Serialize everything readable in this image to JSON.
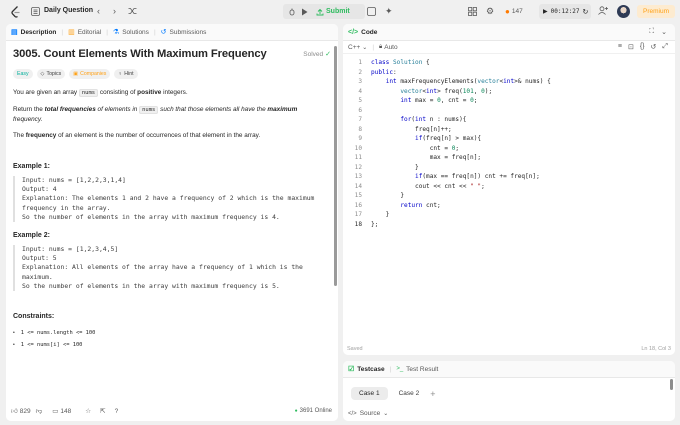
{
  "topbar": {
    "title": "Daily Question",
    "submit_label": "Submit",
    "streak": "147",
    "timer": "00:12:27",
    "premium_label": "Premium"
  },
  "left_tabs": [
    {
      "label": "Description"
    },
    {
      "label": "Editorial"
    },
    {
      "label": "Solutions"
    },
    {
      "label": "Submissions"
    }
  ],
  "problem": {
    "title": "3005. Count Elements With Maximum Frequency",
    "status": "Solved",
    "tags": {
      "difficulty": "Easy",
      "topics": "Topics",
      "companies": "Companies",
      "hint": "Hint"
    },
    "p1_pre": "You are given an array ",
    "p1_code": "nums",
    "p1_mid": " consisting of ",
    "p1_bold": "positive",
    "p1_post": " integers.",
    "p2_pre": "Return the ",
    "p2_bold": "total frequencies",
    "p2_mid": " of elements in ",
    "p2_code": "nums",
    "p2_mid2": " such that those elements all have the ",
    "p2_bold2": "maximum",
    "p2_post": " frequency.",
    "p3_pre": "The ",
    "p3_bold": "frequency",
    "p3_post": " of an element is the number of occurrences of that element in the array.",
    "example1_title": "Example 1:",
    "example1_body": "Input: nums = [1,2,2,3,1,4]\nOutput: 4\nExplanation: The elements 1 and 2 have a frequency of 2 which is the maximum\nfrequency in the array.\nSo the number of elements in the array with maximum frequency is 4.",
    "example2_title": "Example 2:",
    "example2_body": "Input: nums = [1,2,3,4,5]\nOutput: 5\nExplanation: All elements of the array have a frequency of 1 which is the\nmaximum.\nSo the number of elements in the array with maximum frequency is 5.",
    "constraints_title": "Constraints:",
    "constraint1": "1 <= nums.length <= 100",
    "constraint2": "1 <= nums[i] <= 100"
  },
  "left_footer": {
    "likes": "829",
    "comments": "148",
    "online": "3691 Online"
  },
  "code_panel": {
    "title": "Code",
    "language": "C++",
    "auto_label": "Auto",
    "saved": "Saved",
    "cursor": "Ln 18, Col 3"
  },
  "code_lines": [
    {
      "n": "1",
      "html": "<span class=\"kw\">class</span> <span class=\"ty\">Solution</span> {"
    },
    {
      "n": "2",
      "html": "<span class=\"kw\">public</span>:"
    },
    {
      "n": "3",
      "html": "    <span class=\"kw\">int</span> maxFrequencyElements(<span class=\"ty\">vector</span>&lt;<span class=\"kw\">int</span>&gt;&amp; nums) {"
    },
    {
      "n": "4",
      "html": "        <span class=\"ty\">vector</span>&lt;<span class=\"kw\">int</span>&gt; freq(<span class=\"num\">101</span>, <span class=\"num\">0</span>);"
    },
    {
      "n": "5",
      "html": "        <span class=\"kw\">int</span> max = <span class=\"num\">0</span>, cnt = <span class=\"num\">0</span>;"
    },
    {
      "n": "6",
      "html": ""
    },
    {
      "n": "7",
      "html": "        <span class=\"kw\">for</span>(<span class=\"kw\">int</span> n : nums){"
    },
    {
      "n": "8",
      "html": "            freq[n]++;"
    },
    {
      "n": "9",
      "html": "            <span class=\"kw\">if</span>(freq[n] &gt; max){"
    },
    {
      "n": "10",
      "html": "                cnt = <span class=\"num\">0</span>;"
    },
    {
      "n": "11",
      "html": "                max = freq[n];"
    },
    {
      "n": "12",
      "html": "            }"
    },
    {
      "n": "13",
      "html": "            <span class=\"kw\">if</span>(max == freq[n]) cnt += freq[n];"
    },
    {
      "n": "14",
      "html": "            cout &lt;&lt; cnt &lt;&lt; <span class=\"str\">\" \"</span>;"
    },
    {
      "n": "15",
      "html": "        }"
    },
    {
      "n": "16",
      "html": "        <span class=\"kw\">return</span> cnt;"
    },
    {
      "n": "17",
      "html": "    }"
    },
    {
      "n": "18",
      "html": "};"
    }
  ],
  "testcase": {
    "tab_testcase": "Testcase",
    "tab_result": "Test Result",
    "case1": "Case 1",
    "case2": "Case 2",
    "source": "Source"
  },
  "icons": [
    "logo",
    "list-icon",
    "chevron-left-icon",
    "chevron-right-icon",
    "shuffle-icon",
    "bug-icon",
    "play-icon",
    "upload-icon",
    "note-icon",
    "sparkle-icon",
    "grid-icon",
    "gear-icon",
    "fire-icon",
    "add-user-icon",
    "avatar"
  ],
  "colors": {
    "submit_green": "#2cbb5d",
    "premium_orange": "#ffa116",
    "solved_green": "#2cbb5d",
    "easy_teal": "#00af9b"
  }
}
